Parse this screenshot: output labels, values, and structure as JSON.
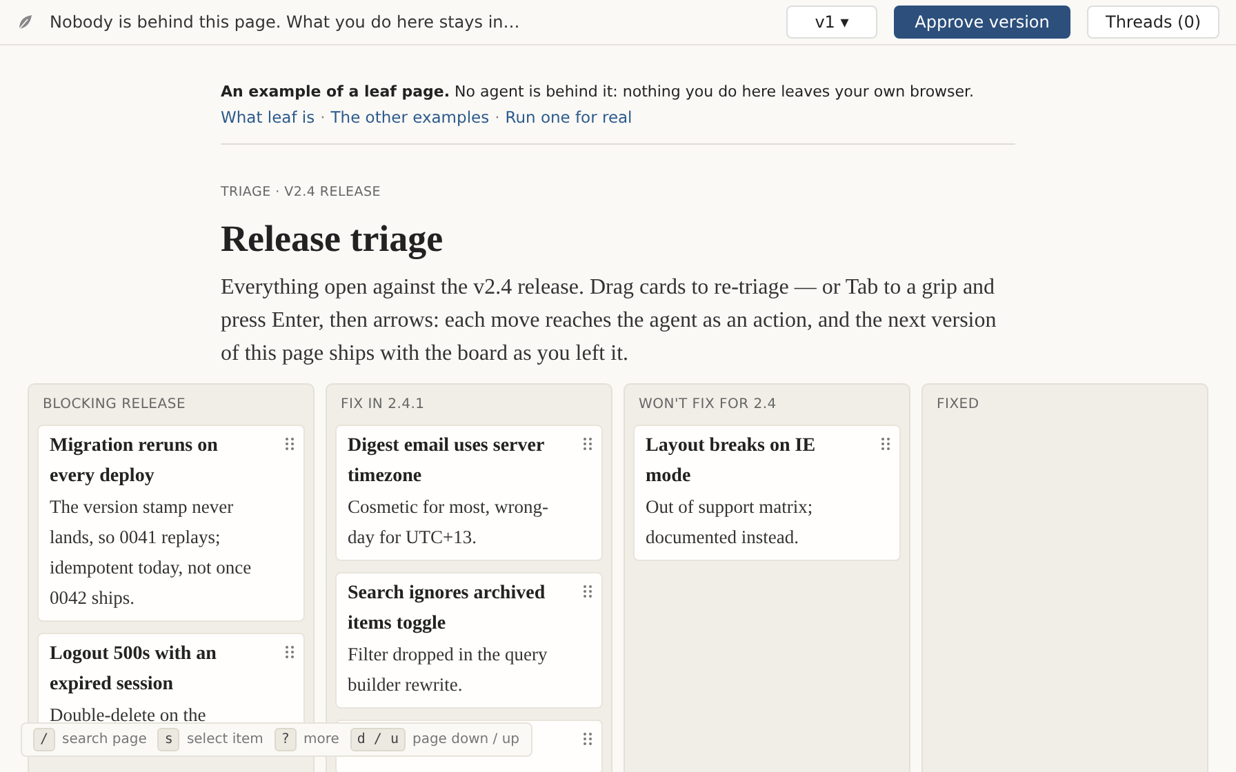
{
  "top_bar": {
    "notice": "Nobody is behind this page. What you do here stays in…",
    "version_select": "v1 ▾",
    "approve_button": "Approve version",
    "threads_button": "Threads (0)"
  },
  "intro": {
    "text": "**An example of a leaf page.** No agent is behind it: nothing you do here leaves your own browser.",
    "links": [
      "What leaf is",
      "The other examples",
      "Run one for real"
    ],
    "separator": "·"
  },
  "eyebrow": "TRIAGE · V2.4 RELEASE",
  "title": "Release triage",
  "description": "Everything open against the v2.4 release. Drag cards to re-triage — or Tab to a grip and press Enter, then arrows: each move reaches the agent as an action, and the next version of this page ships with the board as you left it.",
  "columns": [
    {
      "title": "BLOCKING RELEASE",
      "cards": [
        {
          "title": "Migration reruns on every deploy",
          "body": "The version stamp never lands, so 0041 replays; idempotent today, not once 0042 ships.",
          "draggable": true
        },
        {
          "title": "Logout 500s with an expired session",
          "body": "Double-delete on the",
          "draggable": true
        }
      ]
    },
    {
      "title": "FIX IN 2.4.1",
      "cards": [
        {
          "title": "Digest email uses server timezone",
          "body": "Cosmetic for most, wrong-day for UTC+13.",
          "draggable": true
        },
        {
          "title": "Search ignores archived items toggle",
          "body": "Filter dropped in the query builder rewrite.",
          "draggable": true
        },
        {
          "draggable": true
        }
      ]
    },
    {
      "title": "WON'T FIX FOR 2.4",
      "cards": [
        {
          "title": "Layout breaks on IE mode",
          "body": "Out of support matrix; documented instead.",
          "draggable": true
        }
      ]
    },
    {
      "title": "FIXED"
    }
  ],
  "shortcuts": [
    {
      "key": "/",
      "label": "search page"
    },
    {
      "key": "s",
      "label": "select item"
    },
    {
      "key": "?",
      "label": "more"
    },
    {
      "key": "d / u",
      "label": "page down / up"
    }
  ]
}
